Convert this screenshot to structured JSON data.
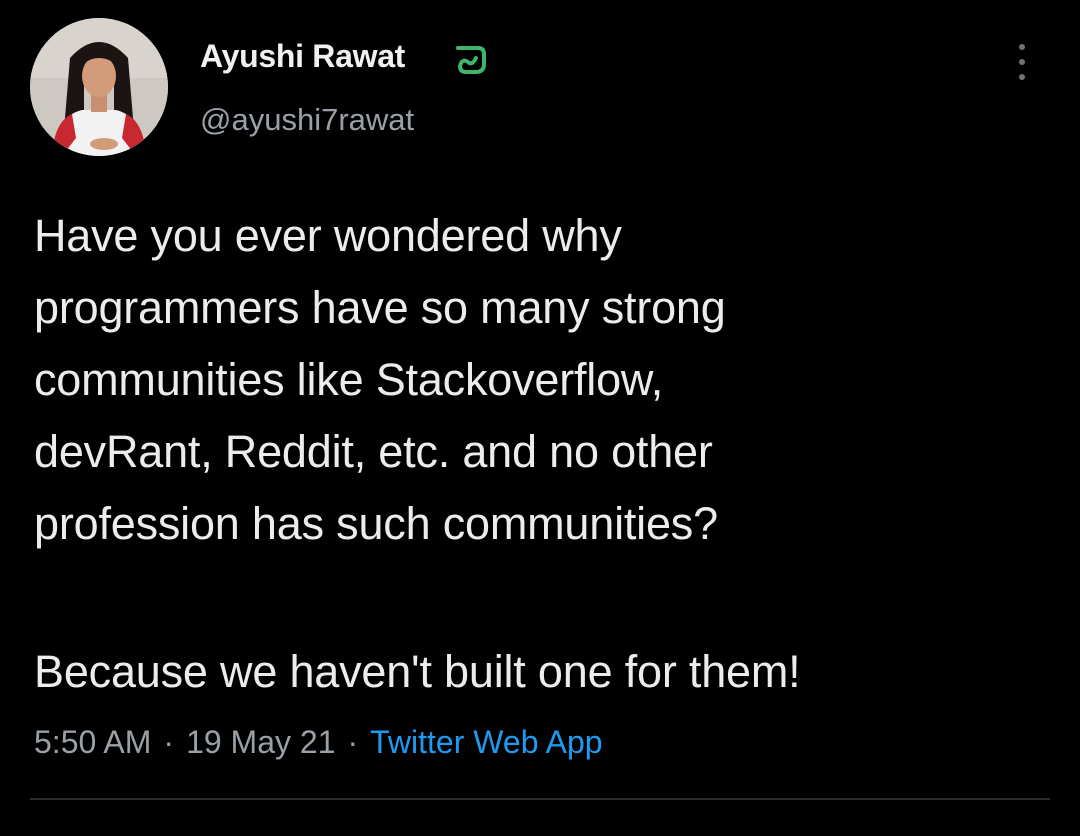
{
  "author": {
    "name": "Ayushi Rawat",
    "handle": "@ayushi7rawat"
  },
  "tweet": {
    "question": "Have you ever wondered why\nprogrammers have so many strong\ncommunities like Stackoverflow,\ndevRant, Reddit, etc. and no other\nprofession has such communities?",
    "answer": "Because we haven't built one for them!"
  },
  "meta": {
    "time": "5:50 AM",
    "separator": "·",
    "date": "19 May 21",
    "source": "Twitter Web App"
  },
  "icons": {
    "badge": "badge-icon",
    "more": "more-options-icon"
  },
  "colors": {
    "background": "#000000",
    "text": "#ececec",
    "muted": "#9aa0a6",
    "link": "#1d9bf0",
    "badge": "#3fb56b"
  }
}
